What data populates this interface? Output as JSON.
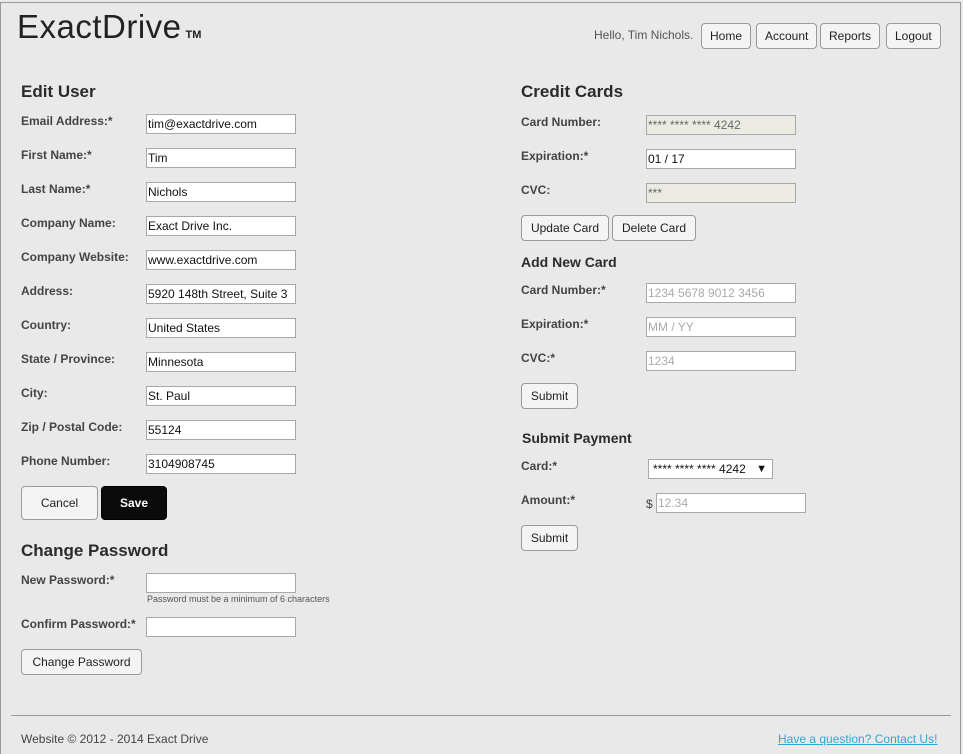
{
  "brand": {
    "name": "ExactDrive",
    "tm": "TM"
  },
  "header": {
    "greeting": "Hello, Tim Nichols.",
    "nav": {
      "home": "Home",
      "account": "Account",
      "reports": "Reports",
      "logout": "Logout"
    }
  },
  "edit_user": {
    "title": "Edit User",
    "fields": {
      "email": {
        "label": "Email Address:*",
        "value": "tim@exactdrive.com"
      },
      "first_name": {
        "label": "First Name:*",
        "value": "Tim"
      },
      "last_name": {
        "label": "Last Name:*",
        "value": "Nichols"
      },
      "company_name": {
        "label": "Company Name:",
        "value": "Exact Drive Inc."
      },
      "company_website": {
        "label": "Company Website:",
        "value": "www.exactdrive.com"
      },
      "address": {
        "label": "Address:",
        "value": "5920 148th Street, Suite 3"
      },
      "country": {
        "label": "Country:",
        "value": "United States"
      },
      "state": {
        "label": "State / Province:",
        "value": "Minnesota"
      },
      "city": {
        "label": "City:",
        "value": "St. Paul"
      },
      "zip": {
        "label": "Zip / Postal Code:",
        "value": "55124"
      },
      "phone": {
        "label": "Phone Number:",
        "value": "3104908745"
      }
    },
    "cancel_label": "Cancel",
    "save_label": "Save"
  },
  "change_password": {
    "title": "Change Password",
    "new_label": "New Password:*",
    "hint": "Password must be a minimum of 6 characters",
    "confirm_label": "Confirm Password:*",
    "button_label": "Change Password"
  },
  "credit_cards": {
    "title": "Credit Cards",
    "card_number_label": "Card Number:",
    "card_number_value": "**** **** **** 4242",
    "expiration_label": "Expiration:*",
    "expiration_value": "01 / 17",
    "cvc_label": "CVC:",
    "cvc_value": "***",
    "update_label": "Update Card",
    "delete_label": "Delete Card"
  },
  "add_card": {
    "title": "Add New Card",
    "card_number_label": "Card Number:*",
    "card_number_placeholder": "1234 5678 9012 3456",
    "expiration_label": "Expiration:*",
    "expiration_placeholder": "MM / YY",
    "cvc_label": "CVC:*",
    "cvc_placeholder": "1234",
    "submit_label": "Submit"
  },
  "submit_payment": {
    "title": "Submit Payment",
    "card_label": "Card:*",
    "card_selected": "**** **** **** 4242",
    "amount_label": "Amount:*",
    "currency": "$",
    "amount_placeholder": "12.34",
    "submit_label": "Submit"
  },
  "footer": {
    "copyright": "Website © 2012 - 2014 Exact Drive",
    "contact": "Have a question? Contact Us!"
  }
}
